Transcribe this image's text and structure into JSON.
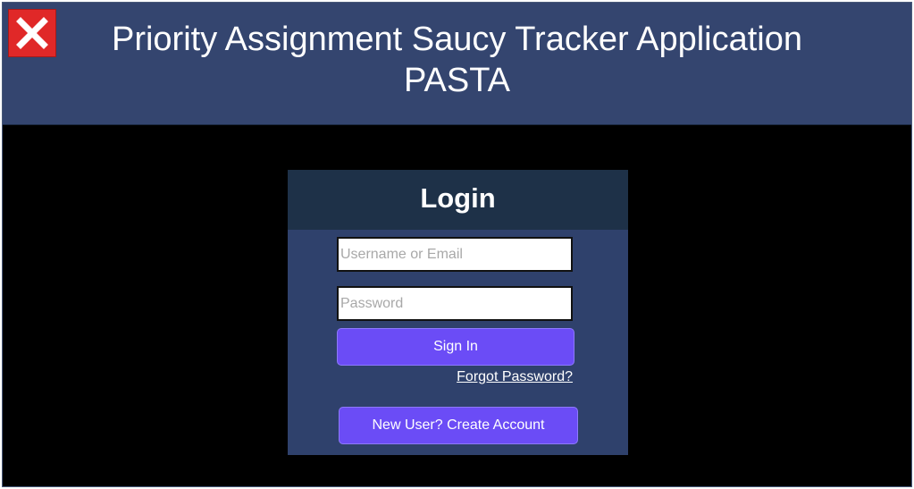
{
  "header": {
    "title_line1": "Priority Assignment Saucy Tracker Application",
    "title_line2": "PASTA",
    "close_icon": "close-x-icon",
    "colors": {
      "background": "#34456f",
      "close_button": "#e02828"
    }
  },
  "login": {
    "title": "Login",
    "username_placeholder": "Username or Email",
    "username_value": "",
    "password_placeholder": "Password",
    "password_value": "",
    "sign_in_label": "Sign In",
    "forgot_password_label": "Forgot Password?",
    "create_account_label": "New User? Create Account",
    "colors": {
      "card": "#2f416c",
      "card_header": "#1e3148",
      "button": "#6b4cf6",
      "page_background": "#000000"
    }
  }
}
